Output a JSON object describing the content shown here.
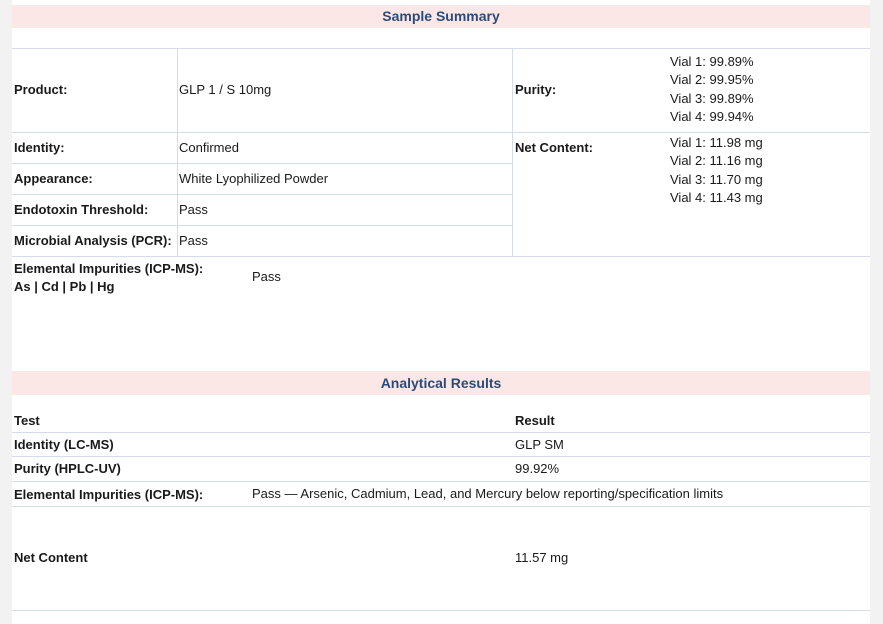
{
  "sample_summary": {
    "title": "Sample Summary",
    "product_label": "Product:",
    "product_value": "GLP 1 / S 10mg",
    "purity_label": "Purity:",
    "purity_values": [
      "Vial 1: 99.89%",
      "Vial 2: 99.95%",
      "Vial 3: 99.89%",
      "Vial 4: 99.94%"
    ],
    "identity_label": "Identity:",
    "identity_value": "Confirmed",
    "net_content_label": "Net Content:",
    "net_content_values": [
      "Vial 1: 11.98 mg",
      "Vial 2: 11.16 mg",
      "Vial 3: 11.70 mg",
      "Vial 4: 11.43 mg"
    ],
    "appearance_label": "Appearance:",
    "appearance_value": "White Lyophilized Powder",
    "endotoxin_label": "Endotoxin Threshold:",
    "endotoxin_value": "Pass",
    "microbial_label": "Microbial Analysis (PCR):",
    "microbial_value": "Pass",
    "elemental_label_line1": "Elemental Impurities (ICP-MS):",
    "elemental_label_line2": "As | Cd | Pb | Hg",
    "elemental_value": "Pass"
  },
  "analytical_results": {
    "title": "Analytical Results",
    "col_test": "Test",
    "col_result": "Result",
    "rows": [
      {
        "test": "Identity (LC-MS)",
        "result": "GLP SM"
      },
      {
        "test": "Purity (HPLC-UV)",
        "result": "99.92%"
      },
      {
        "test": "Elemental Impurities (ICP-MS):",
        "result": "Pass — Arsenic, Cadmium, Lead, and Mercury below reporting/specification limits"
      },
      {
        "test": "Net Content",
        "result": "11.57 mg"
      }
    ]
  },
  "colors": {
    "header_band": "#fbe8e6",
    "header_text": "#2c4a7a",
    "grid_line": "#d2dde9",
    "side_strip": "#f2f2f2"
  }
}
